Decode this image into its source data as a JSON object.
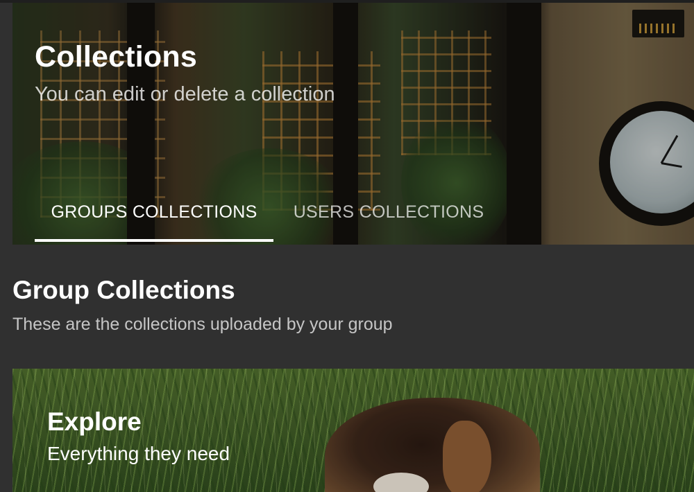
{
  "header": {
    "title": "Collections",
    "subtitle": "You can edit or delete a collection"
  },
  "tabs": [
    {
      "label": "GROUPS COLLECTIONS",
      "active": true
    },
    {
      "label": "USERS COLLECTIONS",
      "active": false
    }
  ],
  "section": {
    "title": "Group Collections",
    "subtitle": "These are the collections uploaded by your group"
  },
  "collections": [
    {
      "title": "Explore",
      "subtitle": "Everything they need"
    }
  ],
  "colors": {
    "background": "#303030",
    "text": "#ffffff",
    "tab_indicator": "#ffffff"
  }
}
